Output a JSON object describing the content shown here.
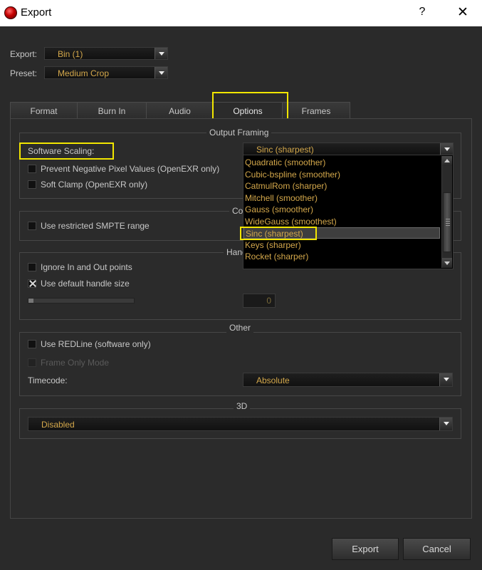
{
  "window": {
    "title": "Export",
    "help": "?",
    "close": "✕"
  },
  "header": {
    "export_label": "Export:",
    "export_value": "Bin (1)",
    "preset_label": "Preset:",
    "preset_value": "Medium Crop"
  },
  "tabs": [
    {
      "label": "Format"
    },
    {
      "label": "Burn In"
    },
    {
      "label": "Audio"
    },
    {
      "label": "Options"
    },
    {
      "label": "Frames"
    }
  ],
  "output_framing": {
    "title": "Output Framing",
    "scaling_label": "Software Scaling:",
    "scaling_value": "Sinc (sharpest)",
    "prevent_negative": "Prevent Negative Pixel Values (OpenEXR only)",
    "soft_clamp": "Soft Clamp (OpenEXR only)",
    "options": [
      "Quadratic (smoother)",
      "Cubic-bspline (smoother)",
      "CatmulRom (sharper)",
      "Mitchell (smoother)",
      "Gauss (smoother)",
      "WideGauss (smoothest)",
      "Sinc (sharpest)",
      "Keys (sharper)",
      "Rocket (sharper)"
    ]
  },
  "color": {
    "title_fragment": "Co",
    "smpte": "Use restricted SMPTE range"
  },
  "handles": {
    "title_fragment": "Hand",
    "ignore_in_out": "Ignore In and Out points",
    "default_handle": "Use default handle size",
    "handle_value": "0",
    "slider_fraction": 0.05
  },
  "other": {
    "title": "Other",
    "redline": "Use REDLine (software only)",
    "frame_only": "Frame Only Mode",
    "timecode_label": "Timecode:",
    "timecode_value": "Absolute"
  },
  "three_d": {
    "title": "3D",
    "value": "Disabled"
  },
  "buttons": {
    "export": "Export",
    "cancel": "Cancel"
  },
  "colors": {
    "accent_text": "#d4a84b",
    "highlight": "#f2e600",
    "background": "#2a2a2a"
  }
}
